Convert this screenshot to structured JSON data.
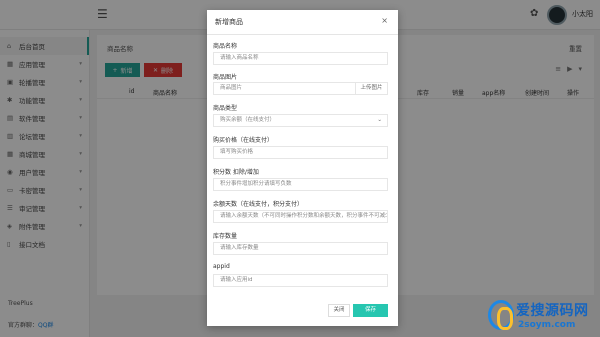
{
  "topbar": {
    "menu_icon": "menu-icon",
    "palette_icon": "palette-icon",
    "username": "小太阳"
  },
  "sidebar": {
    "items": [
      {
        "icon": "home-icon",
        "glyph": "⌂",
        "label": "后台首页",
        "arrow": false,
        "active": true
      },
      {
        "icon": "grid-icon",
        "glyph": "▦",
        "label": "应用管理",
        "arrow": true
      },
      {
        "icon": "image-icon",
        "glyph": "▣",
        "label": "轮播管理",
        "arrow": true
      },
      {
        "icon": "settings-icon",
        "glyph": "✱",
        "label": "功能管理",
        "arrow": true
      },
      {
        "icon": "box-icon",
        "glyph": "▤",
        "label": "软件管理",
        "arrow": true
      },
      {
        "icon": "cart-icon",
        "glyph": "▥",
        "label": "论坛管理",
        "arrow": true
      },
      {
        "icon": "shop-icon",
        "glyph": "▦",
        "label": "商城管理",
        "arrow": true
      },
      {
        "icon": "user-icon",
        "glyph": "◉",
        "label": "用户管理",
        "arrow": true
      },
      {
        "icon": "card-icon",
        "glyph": "▭",
        "label": "卡密管理",
        "arrow": true
      },
      {
        "icon": "list-icon",
        "glyph": "☰",
        "label": "审记管理",
        "arrow": true
      },
      {
        "icon": "pin-icon",
        "glyph": "◈",
        "label": "附件管理",
        "arrow": true
      },
      {
        "icon": "doc-icon",
        "glyph": "▯",
        "label": "接口文档",
        "arrow": false
      }
    ],
    "brand": "TreePlus",
    "group_label": "官方群聊：",
    "group_link": "QQ群"
  },
  "main": {
    "title": "商品名称",
    "right_text": "重置",
    "new_button": "新增",
    "delete_button": "删除",
    "tools": [
      "≡",
      "▶",
      "▾"
    ],
    "columns": [
      "id",
      "商品名称",
      "库存",
      "销量",
      "app名称",
      "创建时间",
      "操作"
    ]
  },
  "modal": {
    "title": "新增商品",
    "close_glyph": "×",
    "fields": {
      "name": {
        "label": "商品名称",
        "placeholder": "请输入商品名称"
      },
      "image": {
        "label": "商品图片",
        "placeholder": "商品图片",
        "upload": "上传图片"
      },
      "type": {
        "label": "商品类型",
        "value": "购买余额（在线支付）"
      },
      "price": {
        "label": "购买价格（在线支付）",
        "placeholder": "填写购买价格"
      },
      "points": {
        "label": "积分数 扣除/增加",
        "placeholder": "积分事件增加积分请填写负数"
      },
      "balance": {
        "label": "余额天数（在线支付，积分支付）",
        "placeholder": "请输入余额天数（不可同时操作积分数和余额天数，积分事件不可减少)"
      },
      "stock": {
        "label": "库存数量",
        "placeholder": "请输入库存数量"
      },
      "appid": {
        "label": "appid",
        "placeholder": "请输入应用id"
      }
    },
    "close_button": "关闭",
    "save_button": "保存"
  },
  "watermark": {
    "title": "爱搜源码网",
    "url": "2soym.com"
  },
  "colors": {
    "accent": "#26a69a",
    "save": "#26c6b0",
    "danger": "#e53935"
  }
}
